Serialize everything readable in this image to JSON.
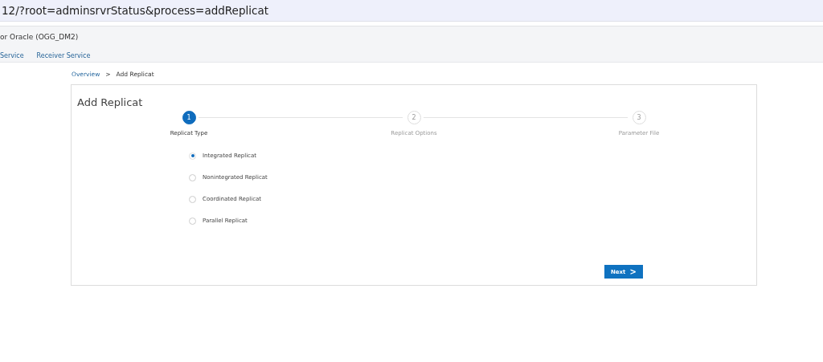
{
  "address_bar": {
    "url": "12/?root=adminsrvrStatus&process=addReplicat"
  },
  "header": {
    "title": "or Oracle (OGG_DM2)",
    "nav": [
      {
        "label": "Service"
      },
      {
        "label": "Receiver Service"
      }
    ]
  },
  "breadcrumb": [
    {
      "label": "Overview",
      "kind": "link"
    },
    {
      "label": ">",
      "kind": "separator"
    },
    {
      "label": "Add Replicat",
      "kind": "current"
    }
  ],
  "card": {
    "title": "Add Replicat",
    "steps": [
      {
        "number": "1",
        "label": "Replicat Type",
        "selected": true
      },
      {
        "number": "2",
        "label": "Replicat Options",
        "selected": false
      },
      {
        "number": "3",
        "label": "Parameter File",
        "selected": false
      }
    ],
    "options": [
      {
        "label": "Integrated Replicat",
        "selected": true
      },
      {
        "label": "Nonintegrated Replicat",
        "selected": false
      },
      {
        "label": "Coordinated Replicat",
        "selected": false
      },
      {
        "label": "Parallel Replicat",
        "selected": false
      }
    ],
    "next_button": {
      "label": "Next",
      "icon": ">"
    }
  }
}
